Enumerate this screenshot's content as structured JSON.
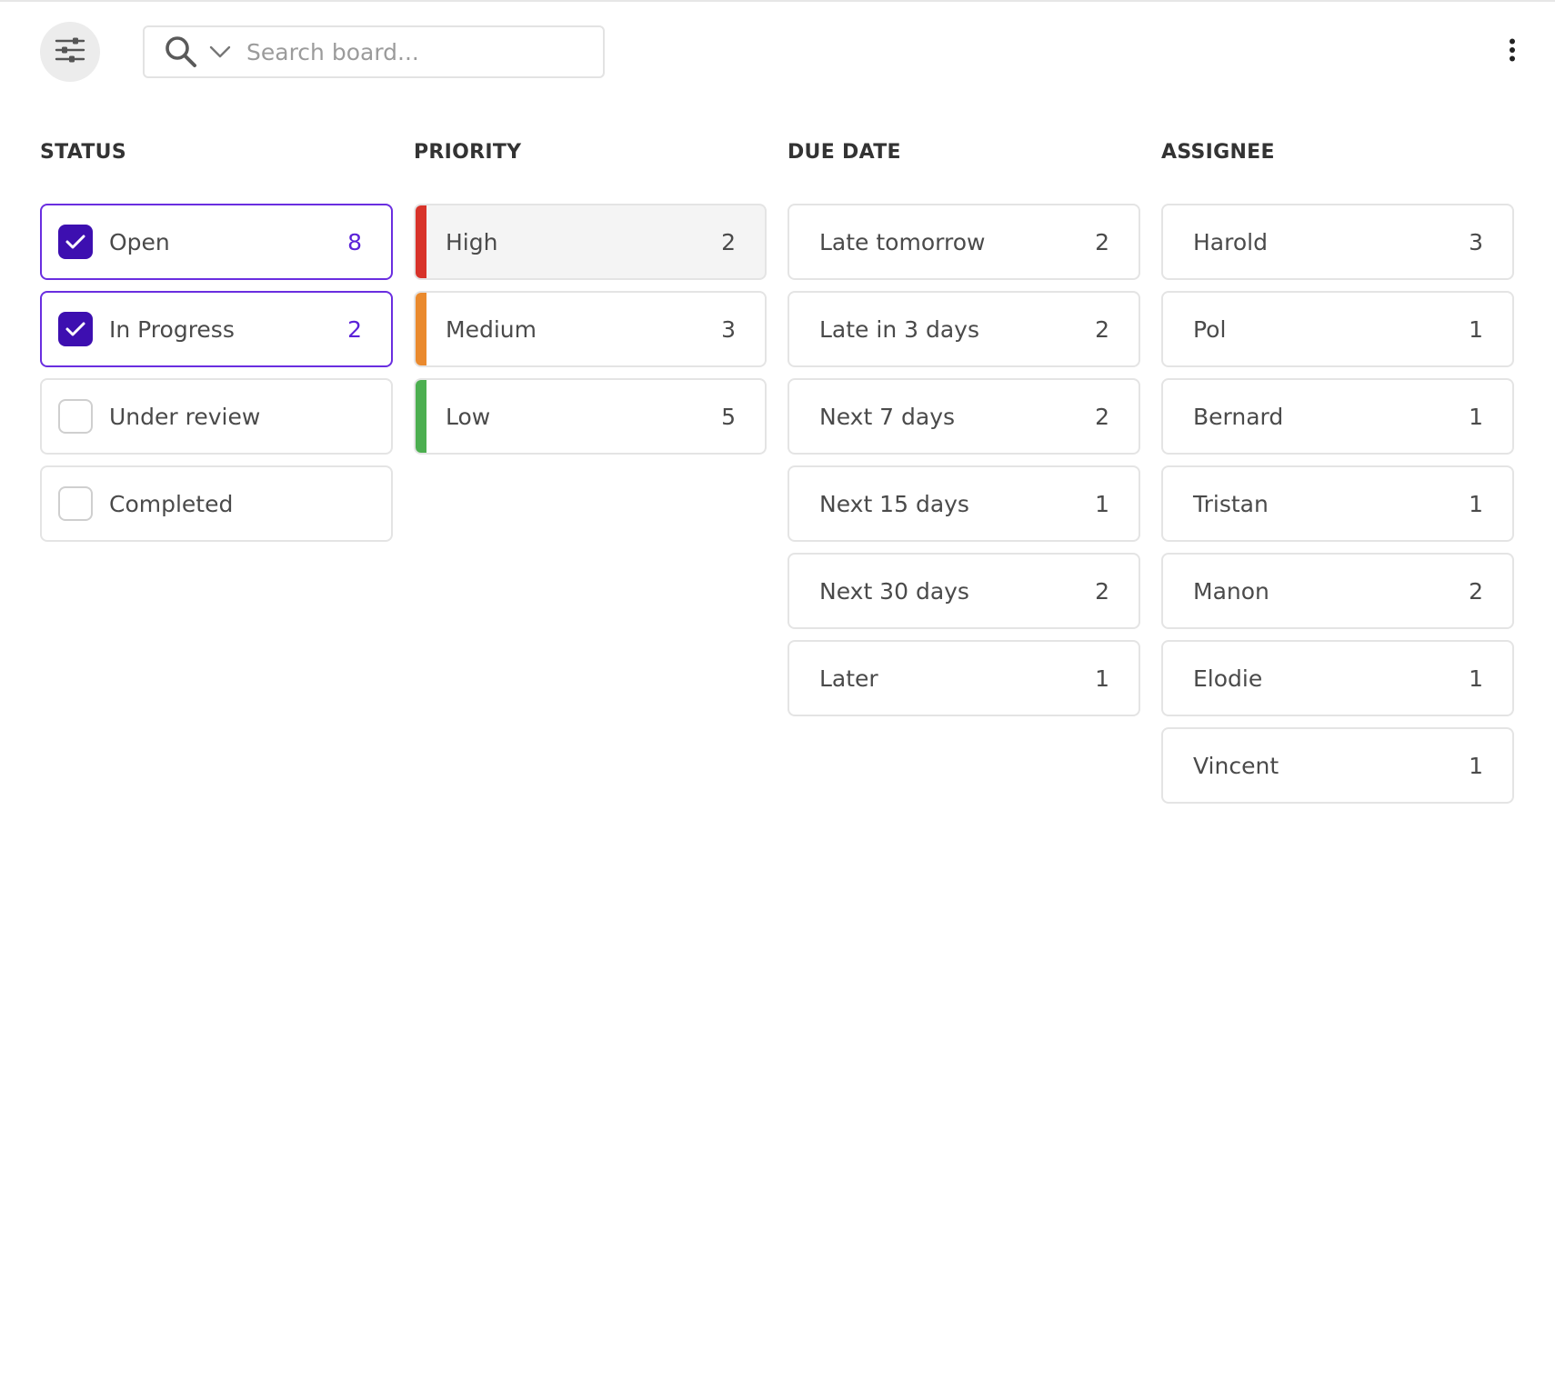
{
  "toolbar": {
    "filter_toggle_icon": "sliders-icon",
    "search": {
      "icon": "search-icon",
      "dropdown_icon": "chevron-down-icon",
      "placeholder": "Search board...",
      "value": ""
    },
    "more_icon": "more-vertical-icon"
  },
  "colors": {
    "accent": "#3d0fb0",
    "selected_border": "#6a2ee0",
    "selected_count": "#5b22d8",
    "priority_high": "#d8332a",
    "priority_medium": "#ea8a2e",
    "priority_low": "#4caf50"
  },
  "filters": {
    "status": {
      "title": "STATUS",
      "items": [
        {
          "label": "Open",
          "count": "8",
          "checked": true
        },
        {
          "label": "In Progress",
          "count": "2",
          "checked": true
        },
        {
          "label": "Under review",
          "count": "",
          "checked": false
        },
        {
          "label": "Completed",
          "count": "",
          "checked": false
        }
      ]
    },
    "priority": {
      "title": "PRIORITY",
      "items": [
        {
          "label": "High",
          "count": "2",
          "color": "#d8332a"
        },
        {
          "label": "Medium",
          "count": "3",
          "color": "#ea8a2e"
        },
        {
          "label": "Low",
          "count": "5",
          "color": "#4caf50"
        }
      ]
    },
    "due_date": {
      "title": "DUE DATE",
      "items": [
        {
          "label": "Late tomorrow",
          "count": "2"
        },
        {
          "label": "Late in 3 days",
          "count": "2"
        },
        {
          "label": "Next 7 days",
          "count": "2"
        },
        {
          "label": "Next 15 days",
          "count": "1"
        },
        {
          "label": "Next 30 days",
          "count": "2"
        },
        {
          "label": "Later",
          "count": "1"
        }
      ]
    },
    "assignee": {
      "title": "ASSIGNEE",
      "items": [
        {
          "label": "Harold",
          "count": "3"
        },
        {
          "label": "Pol",
          "count": "1"
        },
        {
          "label": "Bernard",
          "count": "1"
        },
        {
          "label": "Tristan",
          "count": "1"
        },
        {
          "label": "Manon",
          "count": "2"
        },
        {
          "label": "Elodie",
          "count": "1"
        },
        {
          "label": "Vincent",
          "count": "1"
        }
      ]
    }
  }
}
